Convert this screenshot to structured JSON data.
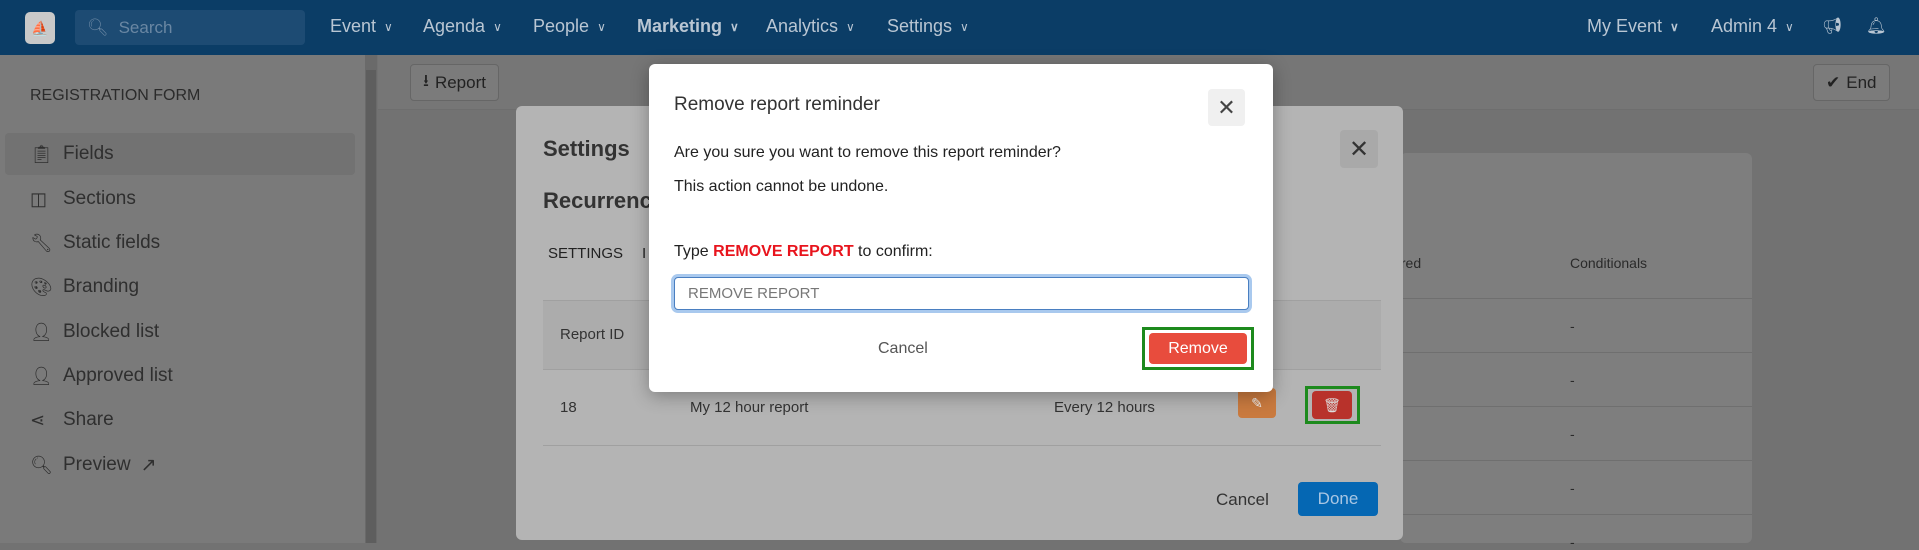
{
  "navbar": {
    "search_placeholder": "Search",
    "menu": [
      {
        "label": "Event"
      },
      {
        "label": "Agenda"
      },
      {
        "label": "People"
      },
      {
        "label": "Marketing"
      },
      {
        "label": "Analytics"
      },
      {
        "label": "Settings"
      }
    ],
    "event_selector": "My Event",
    "user": "Admin 4",
    "icons": [
      "megaphone-icon",
      "bell-icon"
    ]
  },
  "sidebar": {
    "title": "REGISTRATION FORM",
    "items": [
      {
        "label": "Fields",
        "icon": "clipboard-icon",
        "active": true
      },
      {
        "label": "Sections",
        "icon": "columns-icon"
      },
      {
        "label": "Static fields",
        "icon": "wrench-icon"
      },
      {
        "label": "Branding",
        "icon": "palette-icon"
      },
      {
        "label": "Blocked list",
        "icon": "user-x-icon"
      },
      {
        "label": "Approved list",
        "icon": "user-check-icon"
      },
      {
        "label": "Share",
        "icon": "share-icon"
      },
      {
        "label": "Preview",
        "icon": "search-icon"
      }
    ]
  },
  "toolbar": {
    "report_label": "Report",
    "end_label": "End"
  },
  "background_table": {
    "headers": [
      "uired",
      "Conditionals"
    ],
    "rows": [
      "-",
      "-",
      "-",
      "-",
      "-"
    ]
  },
  "settings_modal": {
    "title": "Settings",
    "subtitle": "Recurrenc",
    "tabs": [
      {
        "label": "SETTINGS"
      },
      {
        "label": "I"
      }
    ],
    "table": {
      "headers": [
        "Report ID"
      ],
      "rows": [
        {
          "id": "18",
          "name": "My 12 hour report",
          "frequency": "Every 12 hours"
        }
      ]
    },
    "cancel_label": "Cancel",
    "done_label": "Done"
  },
  "confirm_dialog": {
    "title": "Remove report reminder",
    "line1": "Are you sure you want to remove this report reminder?",
    "line2": "This action cannot be undone.",
    "type_prefix": "Type ",
    "type_keyword": "REMOVE REPORT",
    "type_suffix": " to confirm:",
    "input_value": "REMOVE REPORT",
    "cancel_label": "Cancel",
    "remove_label": "Remove"
  },
  "colors": {
    "navbar": "#0b3d66",
    "remove": "#e84c3d",
    "done": "#0567b3",
    "edit": "#c97a3f",
    "delete": "#b8322b",
    "highlight": "#1d8a1d"
  }
}
